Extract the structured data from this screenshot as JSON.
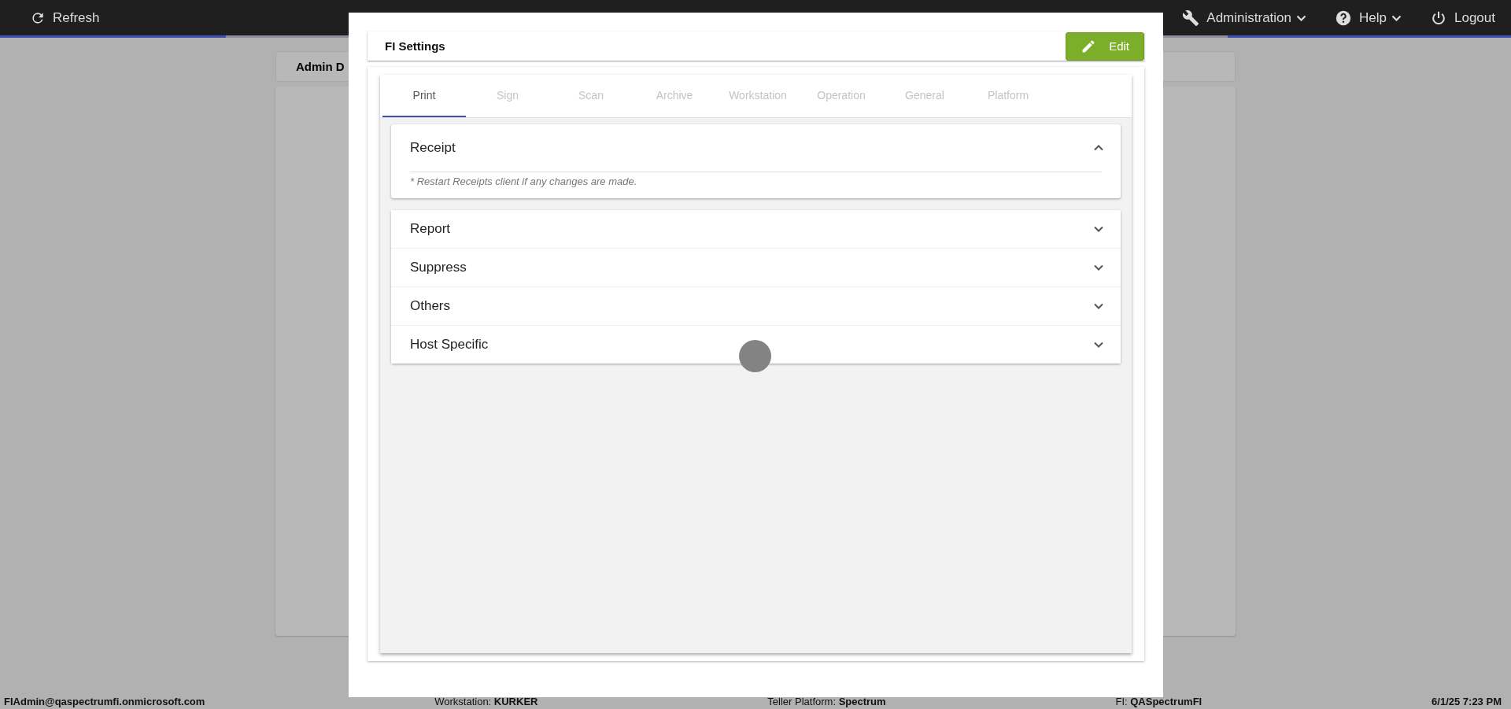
{
  "top_bar": {
    "refresh": "Refresh",
    "menus": [
      {
        "label": "Administration",
        "dropdown": true
      },
      {
        "label": "Help",
        "dropdown": true
      },
      {
        "label": "Logout",
        "dropdown": false
      }
    ]
  },
  "background_panel": {
    "title": "Admin D"
  },
  "dialog": {
    "title": "FI Settings",
    "edit_button": "Edit",
    "tabs": [
      {
        "label": "Print",
        "selected": true
      },
      {
        "label": "Sign",
        "selected": false
      },
      {
        "label": "Scan",
        "selected": false
      },
      {
        "label": "Archive",
        "selected": false
      },
      {
        "label": "Workstation",
        "selected": false
      },
      {
        "label": "Operation",
        "selected": false
      },
      {
        "label": "General",
        "selected": false
      },
      {
        "label": "Platform",
        "selected": false
      }
    ],
    "sections": [
      {
        "title": "Receipt",
        "expanded": true,
        "note": "* Restart Receipts client if any changes are made."
      },
      {
        "title": "Report",
        "expanded": false
      },
      {
        "title": "Suppress",
        "expanded": false
      },
      {
        "title": "Others",
        "expanded": false
      },
      {
        "title": "Host Specific",
        "expanded": false
      }
    ]
  },
  "status_bar": {
    "user": "FIAdmin@qaspectrumfi.onmicrosoft.com",
    "workstation": "Workstation: **KURKER**",
    "platform": "Teller Platform: **Spectrum**",
    "fi": "FI: **QASpectrumFI**",
    "datetime": "6/1/25 7:23 PM"
  }
}
